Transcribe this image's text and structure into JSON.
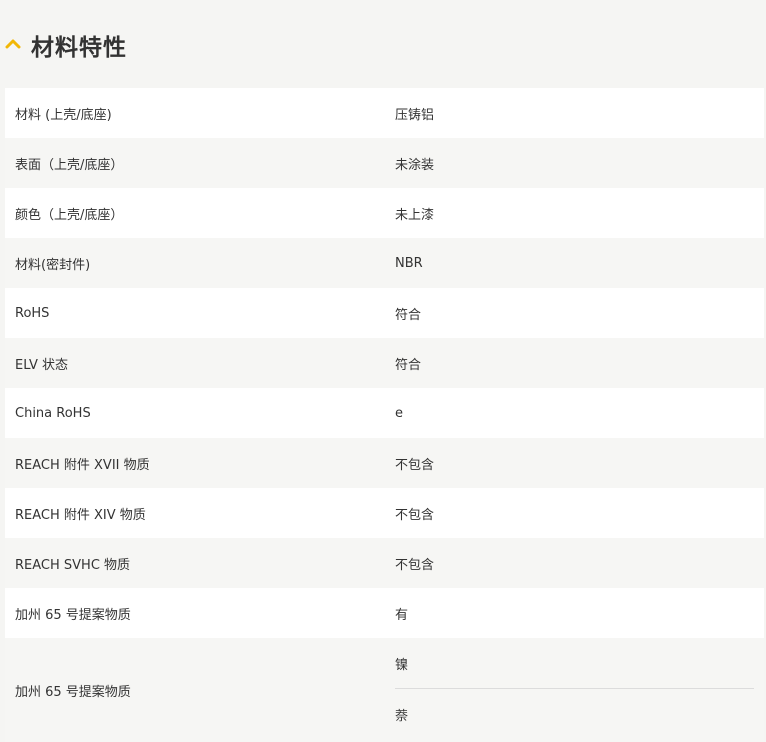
{
  "section": {
    "title": "材料特性",
    "icon": "chevron-up-icon",
    "accent_color": "#f2b705"
  },
  "rows": [
    {
      "label": "材料 (上壳/底座)",
      "value": "压铸铝"
    },
    {
      "label": "表面（上壳/底座）",
      "value": "未涂装"
    },
    {
      "label": "颜色（上壳/底座）",
      "value": "未上漆"
    },
    {
      "label": "材料(密封件)",
      "value": "NBR"
    },
    {
      "label": "RoHS",
      "value": "符合"
    },
    {
      "label": "ELV 状态",
      "value": "符合"
    },
    {
      "label": "China RoHS",
      "value": "e"
    },
    {
      "label": "REACH 附件 XVII 物质",
      "value": "不包含"
    },
    {
      "label": "REACH 附件 XIV 物质",
      "value": "不包含"
    },
    {
      "label": "REACH SVHC 物质",
      "value": "不包含"
    },
    {
      "label": "加州 65 号提案物质",
      "value": "有"
    }
  ],
  "last_row": {
    "label": "加州 65 号提案物质",
    "values": [
      "镍",
      "萘"
    ]
  }
}
